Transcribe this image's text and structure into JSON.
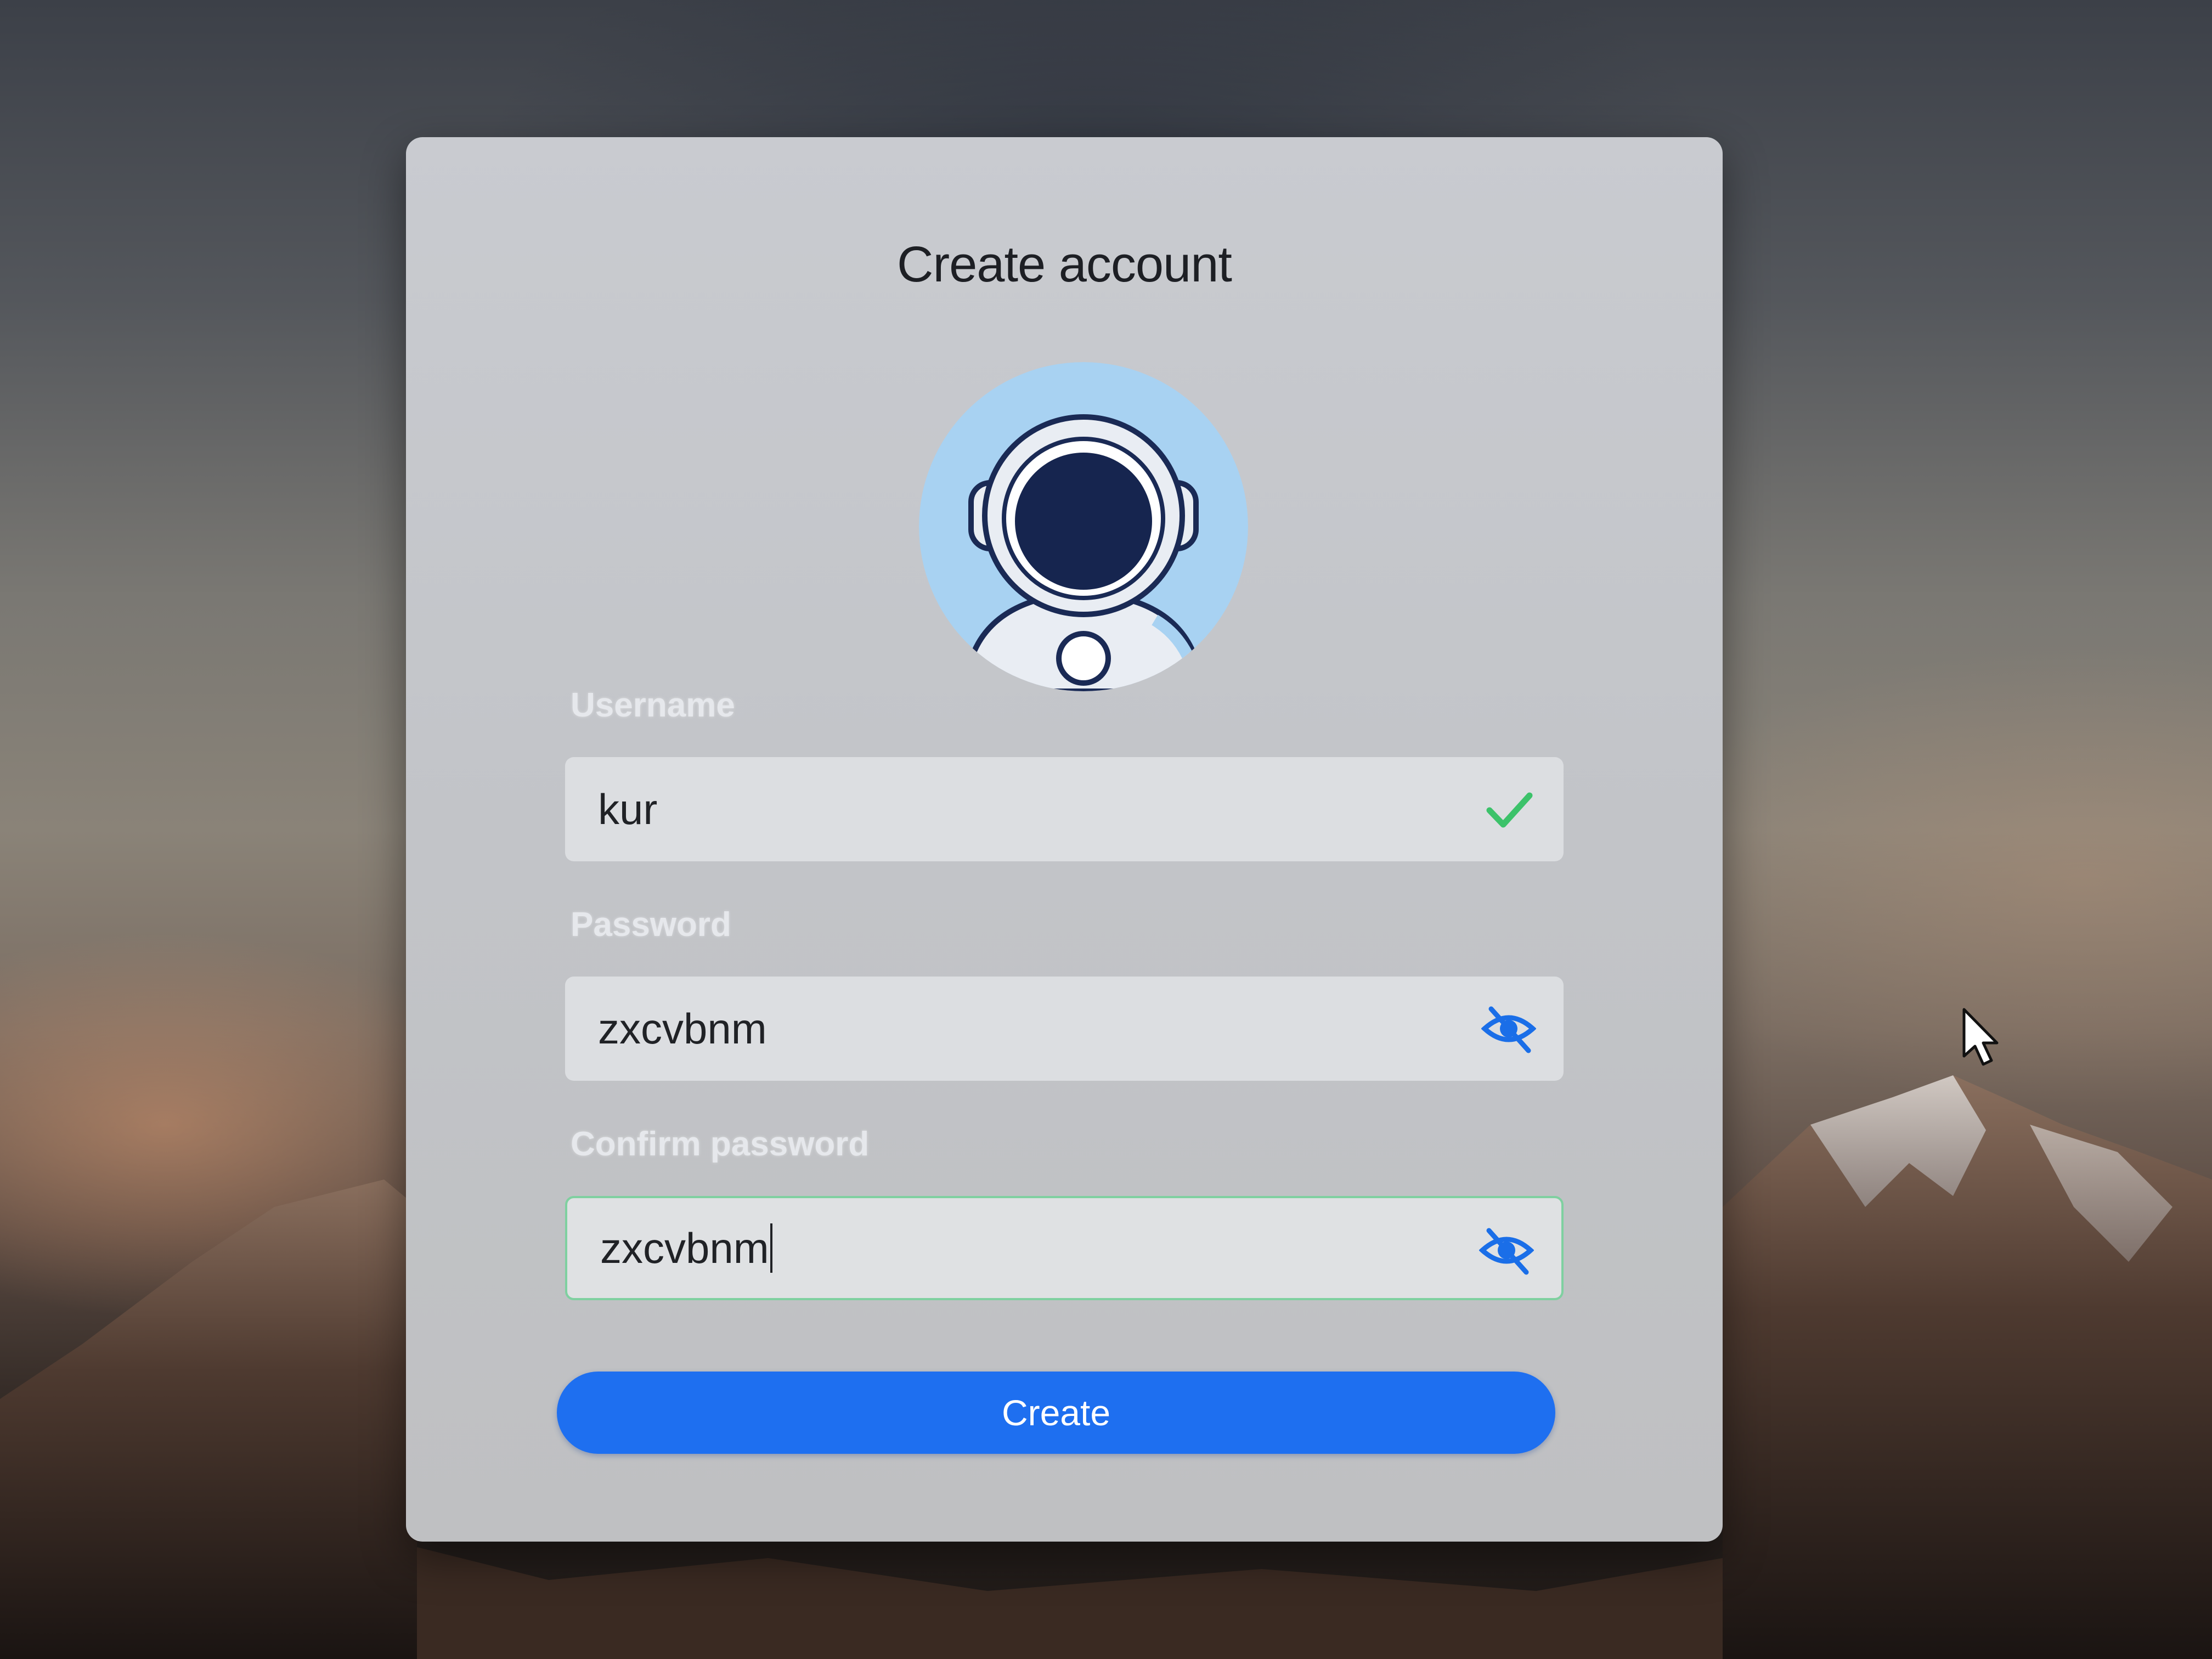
{
  "dialog": {
    "title": "Create account",
    "avatar_icon": "astronaut-avatar"
  },
  "form": {
    "username": {
      "label": "Username",
      "value": "kur",
      "status_icon": "check-icon",
      "status_color": "#3cc26a"
    },
    "password": {
      "label": "Password",
      "value": "zxcvbnm",
      "toggle_icon": "eye-off-icon"
    },
    "confirm_password": {
      "label": "Confirm password",
      "value": "zxcvbnm",
      "toggle_icon": "eye-off-icon"
    },
    "submit_label": "Create"
  },
  "colors": {
    "accent": "#1e6ff0",
    "success": "#3cc26a",
    "icon_blue": "#1a6ee8"
  },
  "cursor_icon": "mouse-pointer-icon"
}
